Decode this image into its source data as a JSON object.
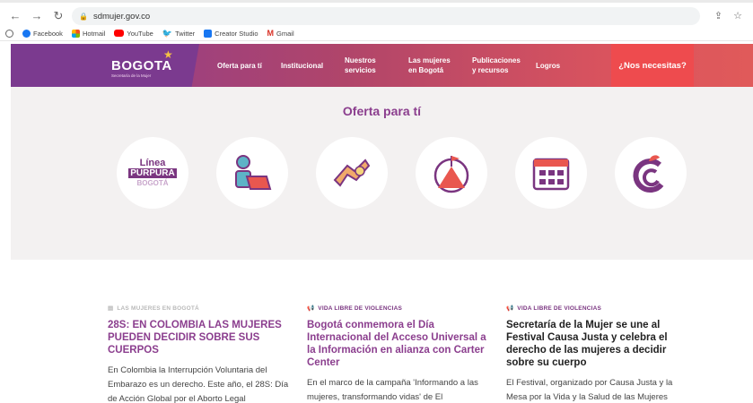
{
  "browser": {
    "url": "sdmujer.gov.co",
    "nav_icons": [
      "back-arrow-icon",
      "forward-arrow-icon",
      "reload-icon"
    ],
    "bookmarks": [
      {
        "label": "Facebook",
        "icon": "facebook-icon"
      },
      {
        "label": "Hotmail",
        "icon": "microsoft-icon"
      },
      {
        "label": "YouTube",
        "icon": "youtube-icon"
      },
      {
        "label": "Twitter",
        "icon": "twitter-icon"
      },
      {
        "label": "Creator Studio",
        "icon": "creator-studio-icon"
      },
      {
        "label": "Gmail",
        "icon": "gmail-icon"
      }
    ]
  },
  "header": {
    "logo_text": "BOGOTA",
    "logo_subtitle": "Secretaría de la Mujer",
    "nav": [
      {
        "line1": "Oferta para tí",
        "line2": ""
      },
      {
        "line1": "Institucional",
        "line2": ""
      },
      {
        "line1": "Nuestros",
        "line2": "servicios"
      },
      {
        "line1": "Las mujeres",
        "line2": "en Bogotá"
      },
      {
        "line1": "Publicaciones",
        "line2": "y recursos"
      },
      {
        "line1": "Logros",
        "line2": ""
      }
    ],
    "cta": "¿Nos necesitas?"
  },
  "offer": {
    "title": "Oferta para tí",
    "linea": {
      "line1": "Línea",
      "line2": "PÚRPURA",
      "line3": "BOGOTÁ"
    },
    "icons": [
      "linea-purpura-icon",
      "person-laptop-icon",
      "hands-icon",
      "mountain-flag-icon",
      "calendar-icon",
      "fruit-logo-icon"
    ]
  },
  "news": [
    {
      "category": "LAS MUJERES EN BOGOTÁ",
      "title": "28S: EN COLOMBIA LAS MUJERES PUEDEN DECIDIR SOBRE SUS CUERPOS",
      "body": "En Colombia la Interrupción Voluntaria del Embarazo es un derecho. Este año, el 28S: Día de Acción Global por el Aborto Legal"
    },
    {
      "category": "VIDA LIBRE DE VIOLENCIAS",
      "title": "Bogotá conmemora el Día Internacional del Acceso Universal a la Información en alianza con Carter Center",
      "body": "En el marco de la campaña 'Informando a las mujeres, transformando vidas' de El"
    },
    {
      "category": "VIDA LIBRE DE VIOLENCIAS",
      "title": "Secretaría de la Mujer se une al Festival Causa Justa y celebra el derecho de las mujeres a decidir sobre su cuerpo",
      "body": "El Festival, organizado por Causa Justa y la Mesa por la Vida y la Salud de las Mujeres"
    }
  ],
  "colors": {
    "brand_purple": "#8b3e8e",
    "header_red": "#e05a5a",
    "cta": "#ee4b4e",
    "offer_bg": "#f3f1f1"
  }
}
